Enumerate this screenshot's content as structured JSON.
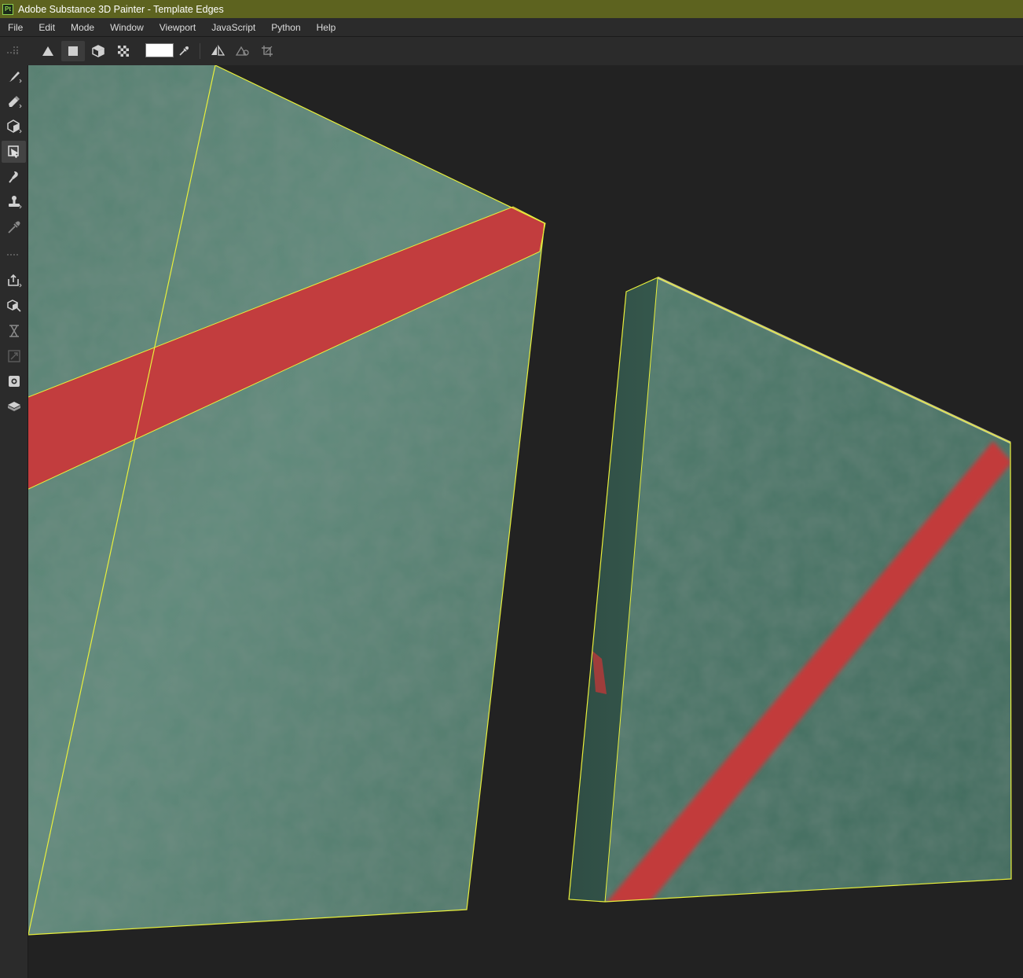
{
  "window": {
    "app_logo": "Pt",
    "title": "Adobe Substance 3D Painter - Template Edges"
  },
  "menu": {
    "items": [
      "File",
      "Edit",
      "Mode",
      "Window",
      "Viewport",
      "JavaScript",
      "Python",
      "Help"
    ]
  },
  "toolbar": {
    "tools": [
      {
        "name": "triangle-fill-mode-icon"
      },
      {
        "name": "polygon-fill-mode-icon",
        "active": true
      },
      {
        "name": "mesh-fill-mode-icon"
      },
      {
        "name": "uv-chunk-fill-mode-icon"
      },
      {
        "name": "color-picker-icon"
      },
      {
        "name": "symmetry-icon"
      },
      {
        "name": "visibility-toggle-icon"
      },
      {
        "name": "crop-icon"
      }
    ],
    "swatch_color": "#ffffff"
  },
  "sidebar": {
    "tools": [
      {
        "name": "paint-brush-icon"
      },
      {
        "name": "eraser-icon"
      },
      {
        "name": "projection-icon"
      },
      {
        "name": "polygon-fill-icon",
        "active": true
      },
      {
        "name": "smudge-icon"
      },
      {
        "name": "clone-stamp-icon"
      },
      {
        "name": "color-picker-tool-icon"
      },
      {
        "name": "export-icon"
      },
      {
        "name": "bake-icon"
      },
      {
        "name": "history-icon"
      },
      {
        "name": "transform-icon"
      },
      {
        "name": "capture-icon"
      },
      {
        "name": "material-icon"
      }
    ]
  },
  "colors": {
    "titlebar": "#5d631f",
    "panel": "#2b2b2b",
    "viewport": "#222222",
    "surface": "#4f7a6c",
    "stripe": "#c23a3a",
    "edge_highlight": "#e9f03c"
  }
}
